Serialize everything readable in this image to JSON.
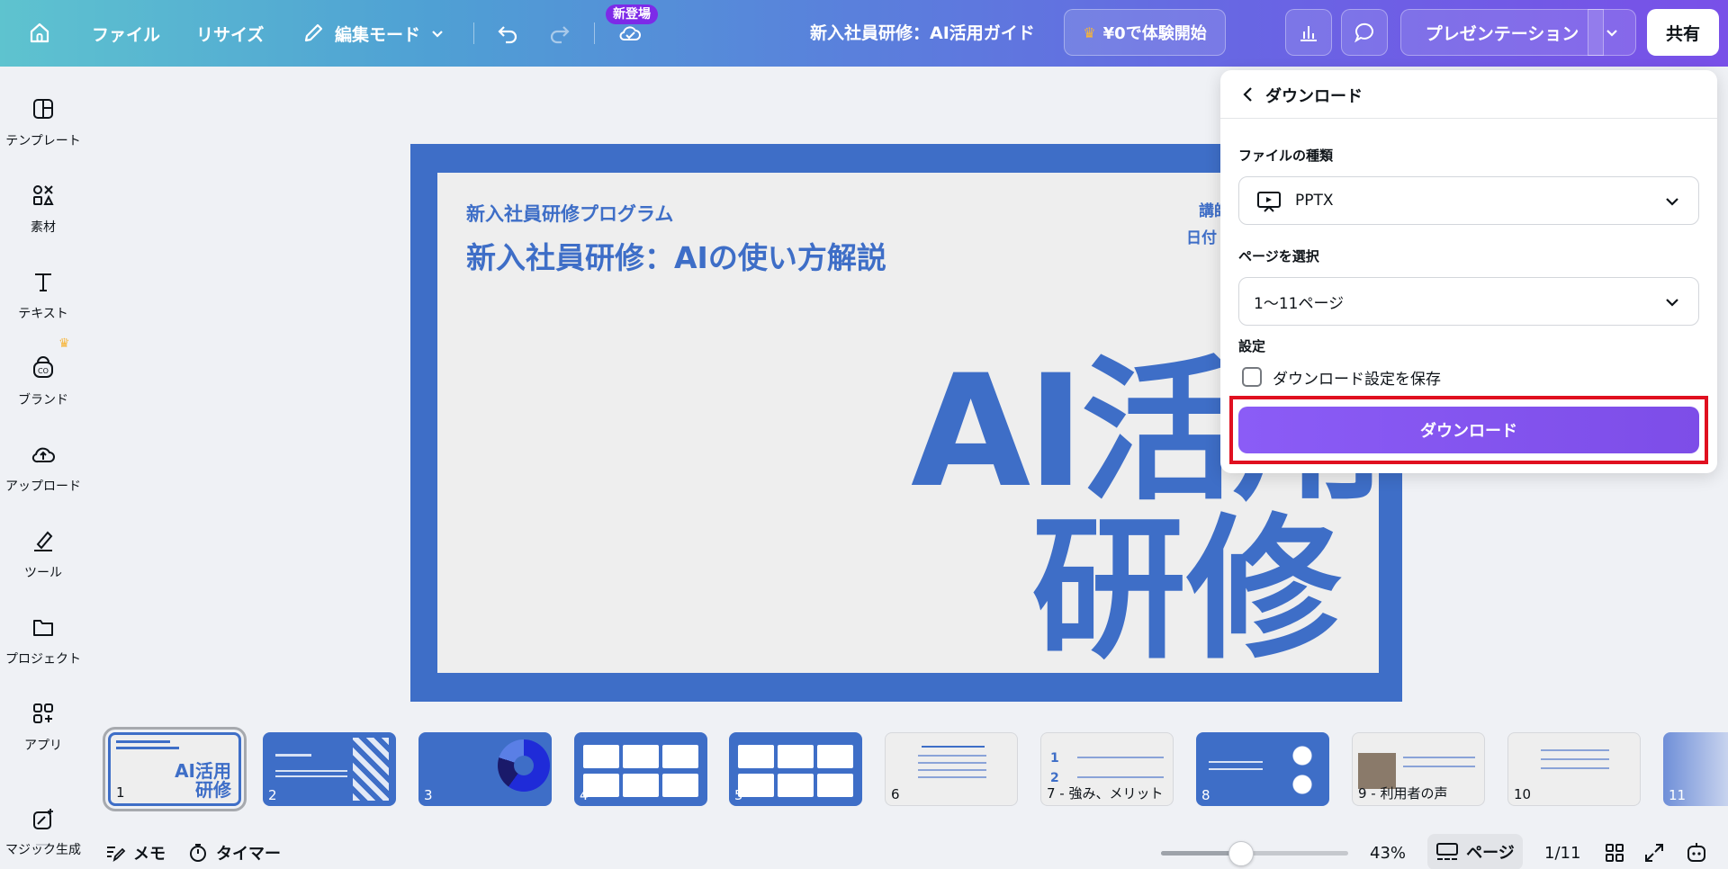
{
  "topbar": {
    "file": "ファイル",
    "resize": "リサイズ",
    "edit_mode": "編集モード",
    "new_badge": "新登場",
    "doc_title": "新入社員研修：AI活用ガイド",
    "trial": "¥0で体験開始",
    "present": "プレゼンテーション",
    "share": "共有"
  },
  "sidebar": {
    "items": [
      {
        "label": "テンプレート",
        "icon": "template-icon"
      },
      {
        "label": "素材",
        "icon": "elements-icon"
      },
      {
        "label": "テキスト",
        "icon": "text-icon"
      },
      {
        "label": "ブランド",
        "icon": "brand-icon"
      },
      {
        "label": "アップロード",
        "icon": "upload-icon"
      },
      {
        "label": "ツール",
        "icon": "draw-icon"
      },
      {
        "label": "プロジェクト",
        "icon": "folder-icon"
      },
      {
        "label": "アプリ",
        "icon": "apps-icon"
      },
      {
        "label": "マジック生成",
        "icon": "magic-icon"
      }
    ]
  },
  "slide": {
    "subtitle": "新入社員研修プログラム",
    "title": "新入社員研修：AIの使い方解説",
    "meta1": "講師",
    "meta2": "日付",
    "big1": "AI活用",
    "big2": "研修"
  },
  "download_panel": {
    "title": "ダウンロード",
    "file_type_label": "ファイルの種類",
    "file_type_value": "PPTX",
    "pages_label": "ページを選択",
    "pages_value": "1〜11ページ",
    "settings_label": "設定",
    "save_settings": "ダウンロード設定を保存",
    "save_settings_checked": false,
    "button": "ダウンロード"
  },
  "thumbnails": [
    {
      "label": "1"
    },
    {
      "label": "2"
    },
    {
      "label": "3"
    },
    {
      "label": "4"
    },
    {
      "label": "5"
    },
    {
      "label": "6"
    },
    {
      "label": "7 - 強み、メリット"
    },
    {
      "label": "8"
    },
    {
      "label": "9 - 利用者の声"
    },
    {
      "label": "10"
    },
    {
      "label": "11"
    }
  ],
  "thumb1_text": "AI活用\n研修",
  "bottombar": {
    "memo": "メモ",
    "timer": "タイマー",
    "zoom": "43%",
    "page_btn": "ページ",
    "page_count": "1/11",
    "zoom_fraction": 0.43
  },
  "colors": {
    "slide_blue": "#3e6ec7",
    "accent_purple": "#7d4de8",
    "highlight_red": "#e01020"
  }
}
